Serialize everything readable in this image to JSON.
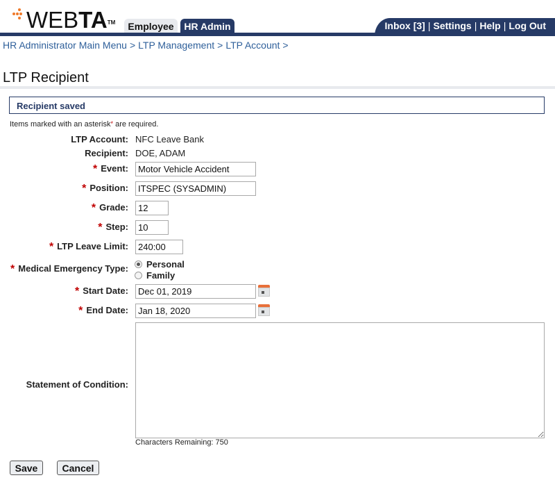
{
  "header": {
    "logo_text_light": "WEB",
    "logo_text_bold": "TA",
    "logo_tm": "TM",
    "tabs": [
      {
        "label": "Employee",
        "active": false
      },
      {
        "label": "HR Admin",
        "active": true
      }
    ],
    "utility_links": [
      {
        "label": "Inbox [3]"
      },
      {
        "label": "Settings"
      },
      {
        "label": "Help"
      },
      {
        "label": "Log Out"
      }
    ],
    "separator": "|"
  },
  "breadcrumb": {
    "items": [
      "HR Administrator Main Menu",
      "LTP Management",
      "LTP Account"
    ],
    "separator": ">"
  },
  "page": {
    "title": "LTP Recipient",
    "message": "Recipient saved",
    "required_note_pre": "Items marked with an asterisk",
    "required_note_ast": "*",
    "required_note_post": " are required."
  },
  "form": {
    "required_marker": "*",
    "ltp_account": {
      "label": "LTP Account:",
      "value": "NFC Leave Bank"
    },
    "recipient": {
      "label": "Recipient:",
      "value": "DOE, ADAM"
    },
    "event": {
      "label": "Event:",
      "value": "Motor Vehicle Accident"
    },
    "position": {
      "label": "Position:",
      "value": "ITSPEC (SYSADMIN)"
    },
    "grade": {
      "label": "Grade:",
      "value": "12"
    },
    "step": {
      "label": "Step:",
      "value": "10"
    },
    "leave_limit": {
      "label": "LTP Leave Limit:",
      "value": "240:00"
    },
    "medical_type": {
      "label": "Medical Emergency Type:",
      "options": [
        {
          "label": "Personal",
          "checked": true
        },
        {
          "label": "Family",
          "checked": false
        }
      ]
    },
    "start_date": {
      "label": "Start Date:",
      "value": "Dec 01, 2019"
    },
    "end_date": {
      "label": "End Date:",
      "value": "Jan 18, 2020"
    },
    "statement": {
      "label": "Statement of Condition:",
      "value": "",
      "chars_remaining": "Characters Remaining: 750"
    }
  },
  "buttons": {
    "save": "Save",
    "cancel": "Cancel"
  },
  "icons": {
    "calendar": "calendar-icon"
  },
  "colors": {
    "brand_navy": "#263a66",
    "accent_orange": "#ef7a2a",
    "required_red": "#c00000",
    "link_blue": "#2e5f9a"
  }
}
